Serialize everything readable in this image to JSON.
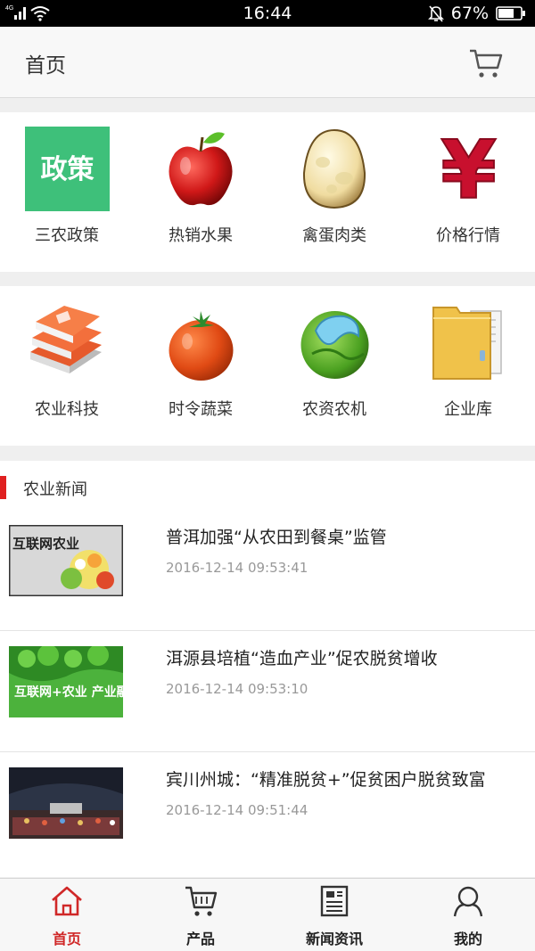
{
  "status": {
    "time": "16:44",
    "net": "4G",
    "battery": "67%"
  },
  "header": {
    "title": "首页"
  },
  "categories_row1": [
    {
      "label": "三农政策",
      "icon": "policy-icon",
      "badge": "政策"
    },
    {
      "label": "热销水果",
      "icon": "apple-icon"
    },
    {
      "label": "禽蛋肉类",
      "icon": "egg-icon"
    },
    {
      "label": "价格行情",
      "icon": "yen-icon"
    }
  ],
  "categories_row2": [
    {
      "label": "农业科技",
      "icon": "books-icon"
    },
    {
      "label": "时令蔬菜",
      "icon": "tomato-icon"
    },
    {
      "label": "农资农机",
      "icon": "sphere-icon"
    },
    {
      "label": "企业库",
      "icon": "folder-icon"
    }
  ],
  "news": {
    "section_title": "农业新闻",
    "items": [
      {
        "title": "普洱加强“从农田到餐桌”监管",
        "date": "2016-12-14 09:53:41",
        "thumb_text": "互联网农业"
      },
      {
        "title": "洱源县培植“造血产业”促农脱贫增收",
        "date": "2016-12-14 09:53:10",
        "thumb_text": "互联网+农业 产业融合新时代"
      },
      {
        "title": "宾川州城：“精准脱贫+”促贫困户脱贫致富",
        "date": "2016-12-14 09:51:44",
        "thumb_text": ""
      }
    ]
  },
  "tabs": [
    {
      "label": "首页",
      "icon": "home-icon",
      "active": true
    },
    {
      "label": "产品",
      "icon": "cart-icon",
      "active": false
    },
    {
      "label": "新闻资讯",
      "icon": "newspaper-icon",
      "active": false
    },
    {
      "label": "我的",
      "icon": "user-icon",
      "active": false
    }
  ],
  "colors": {
    "accent": "#d02828",
    "policy_green": "#3ec07a"
  }
}
